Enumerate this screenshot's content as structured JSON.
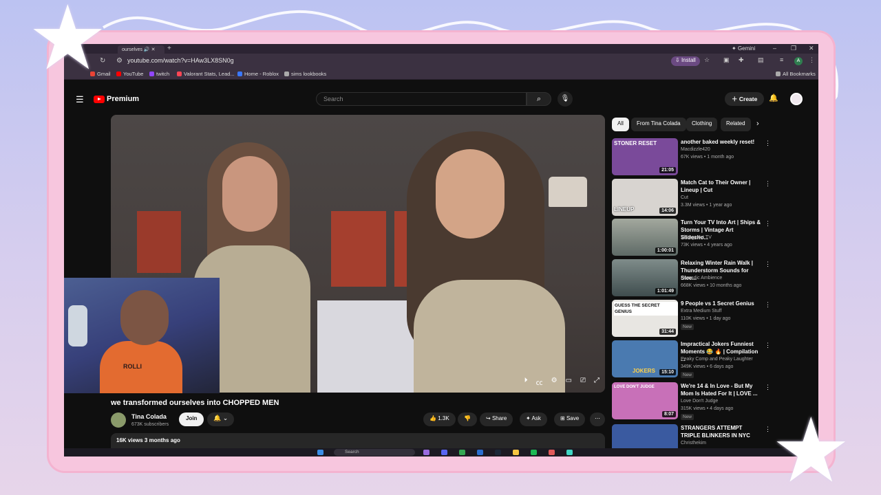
{
  "browser": {
    "tab_title": "ourselves",
    "gemini_label": "Gemini",
    "url": "youtube.com/watch?v=HAw3LX8SN0g",
    "install_label": "Install",
    "bookmarks": [
      {
        "label": "Gmail",
        "color": "#ea4335"
      },
      {
        "label": "YouTube",
        "color": "#ff0000"
      },
      {
        "label": "twitch",
        "color": "#9146ff"
      },
      {
        "label": "Valorant Stats, Lead...",
        "color": "#ff4655"
      },
      {
        "label": "Home - Roblox",
        "color": "#3a78ff"
      },
      {
        "label": "sims lookbooks",
        "color": "#aaaaaa"
      }
    ],
    "all_bookmarks_label": "All Bookmarks"
  },
  "youtube": {
    "logo_text": "Premium",
    "search_placeholder": "Search",
    "create_label": "Create"
  },
  "video": {
    "title": "we transformed ourselves into CHOPPED MEN",
    "channel_name": "Tina Colada",
    "subscribers": "673K subscribers",
    "join_label": "Join",
    "likes": "1.3K",
    "share_label": "Share",
    "ask_label": "Ask",
    "save_label": "Save",
    "views_date": "16K views  3 months ago"
  },
  "webcam": {
    "shirt_text": "ROLLI"
  },
  "chips": [
    "All",
    "From Tina Colada",
    "Clothing",
    "Related"
  ],
  "recommendations": [
    {
      "title": "another baked weekly reset!",
      "channel": "Macdizzle420",
      "meta": "67K views • 1 month ago",
      "duration": "21:05",
      "thumb_text": "STONER RESET",
      "thumb_color": "#7a4a9a",
      "new": ""
    },
    {
      "title": "Match Cat to Their Owner | Lineup | Cut",
      "channel": "Cut",
      "meta": "3.3M views • 1 year ago",
      "duration": "14:06",
      "thumb_text": "LINEUP",
      "thumb_color": "#d8d4d0",
      "new": ""
    },
    {
      "title": "Turn Your TV Into Art | Ships & Storms | Vintage Art Slidesho...",
      "channel": "Vintage Art TV",
      "meta": "73K views • 4 years ago",
      "duration": "1:00:01",
      "thumb_text": "",
      "thumb_color": "#8a8f88",
      "new": ""
    },
    {
      "title": "Relaxing Winter Rain Walk | Thunderstorm Sounds for Slee...",
      "channel": "Nomadic Ambience",
      "meta": "668K views • 10 months ago",
      "duration": "1:01:49",
      "thumb_text": "",
      "thumb_color": "#5c6b6e",
      "new": ""
    },
    {
      "title": "9 People vs 1 Secret Genius",
      "channel": "Extra Medium Stuff",
      "meta": "110K views • 1 day ago",
      "duration": "31:44",
      "thumb_text": "GUESS THE SECRET GENIUS",
      "thumb_color": "#e8e6e2",
      "new": "New"
    },
    {
      "title": "Impractical Jokers Funniest Moments 😂 🔥 | Compilation ...",
      "channel": "Peaky Comp and Peaky Laughter",
      "meta": "349K views • 6 days ago",
      "duration": "15:10",
      "thumb_text": "JOKERS",
      "thumb_color": "#4a7ab0",
      "new": "New"
    },
    {
      "title": "We're 14 & In Love - But My Mom Is Hated For It | LOVE ...",
      "channel": "Love Don't Judge",
      "meta": "315K views • 4 days ago",
      "duration": "8:07",
      "thumb_text": "LOVE DON'T JUDGE",
      "thumb_color": "#c870b8",
      "new": "New"
    },
    {
      "title": "STRANGERS ATTEMPT TRIPLE BLINKERS IN NYC",
      "channel": "Christhekim",
      "meta": "",
      "duration": "",
      "thumb_text": "",
      "thumb_color": "#3a5aa0",
      "new": ""
    }
  ],
  "taskbar": {
    "search_placeholder": "Search"
  }
}
